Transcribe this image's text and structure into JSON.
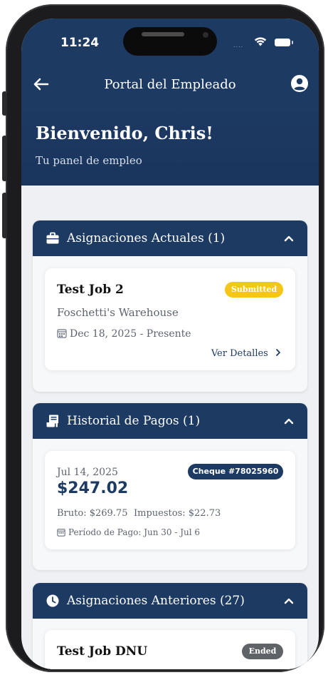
{
  "status_bar": {
    "time": "11:24",
    "signal": "....",
    "icons": [
      "wifi-icon",
      "battery-icon"
    ]
  },
  "app_bar": {
    "title": "Portal del Empleado",
    "back_icon": "arrow-left-icon",
    "account_icon": "account-circle-icon"
  },
  "hero": {
    "greeting": "Bienvenido, Chris!",
    "subtitle": "Tu panel de empleo"
  },
  "current_assignments": {
    "title": "Asignaciones Actuales (1)",
    "icon": "briefcase-icon",
    "items": [
      {
        "job": "Test Job 2",
        "status": "Submitted",
        "company": "Foschetti's Warehouse",
        "dates": "Dec 18, 2025 - Presente",
        "details_link": "Ver Detalles"
      }
    ]
  },
  "payment_history": {
    "title": "Historial de Pagos (1)",
    "icon": "receipt-icon",
    "items": [
      {
        "date": "Jul 14, 2025",
        "amount": "$247.02",
        "check": "Cheque #78025960",
        "gross": "Bruto: $269.75",
        "taxes": "Impuestos: $22.73",
        "period": "Período de Pago: Jun 30 - Jul 6"
      }
    ]
  },
  "past_assignments": {
    "title": "Asignaciones Anteriores (27)",
    "icon": "clock-icon",
    "items": [
      {
        "job": "Test Job DNU",
        "status": "Ended"
      }
    ]
  },
  "colors": {
    "primary": "#1d3a63",
    "submitted_badge": "#f5c518",
    "ended_badge": "#5f6368",
    "background": "#eef0f3"
  }
}
